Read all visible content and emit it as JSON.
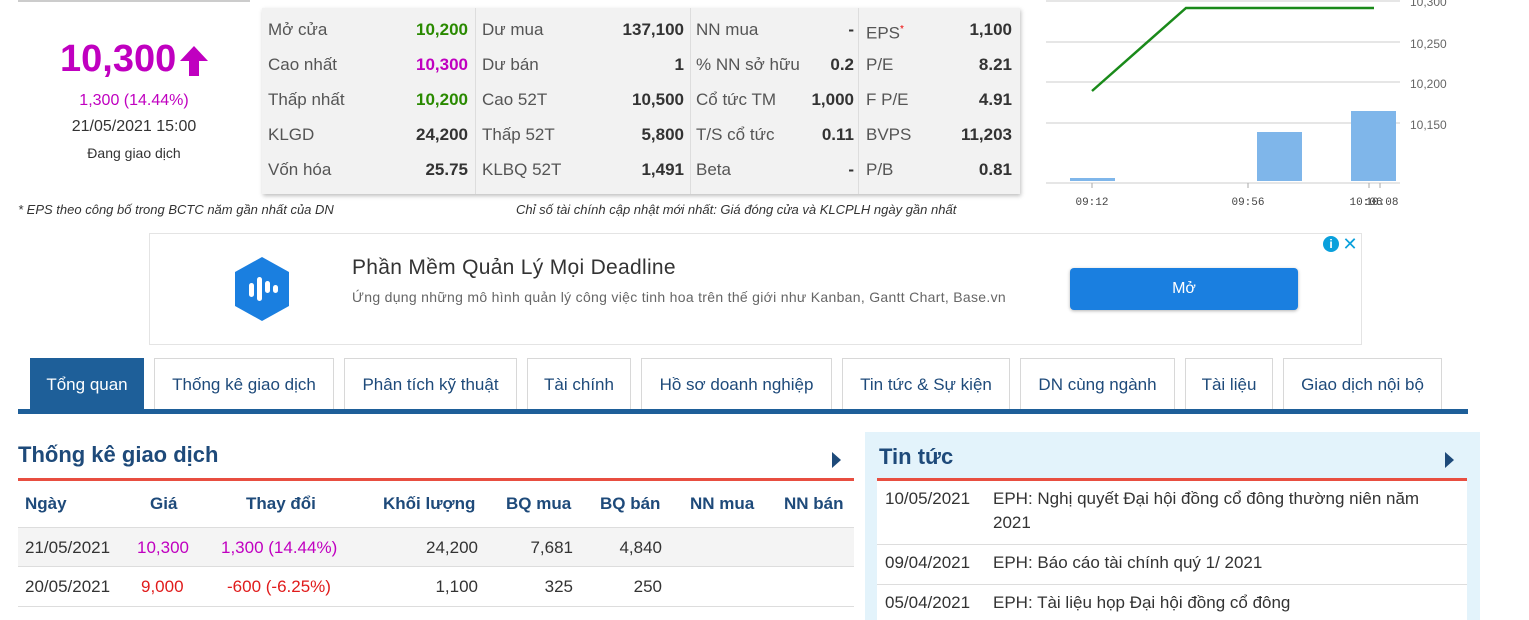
{
  "price": {
    "current": "10,300",
    "change": "1,300 (14.44%)",
    "time": "21/05/2021 15:00",
    "status": "Đang giao dịch"
  },
  "stats": {
    "col1": [
      {
        "label": "Mở cửa",
        "value": "10,200"
      },
      {
        "label": "Cao nhất",
        "value": "10,300"
      },
      {
        "label": "Thấp nhất",
        "value": "10,200"
      },
      {
        "label": "KLGD",
        "value": "24,200"
      },
      {
        "label": "Vốn hóa",
        "value": "25.75"
      }
    ],
    "col2": [
      {
        "label": "Dư mua",
        "value": "137,100"
      },
      {
        "label": "Dư bán",
        "value": "1"
      },
      {
        "label": "Cao 52T",
        "value": "10,500"
      },
      {
        "label": "Thấp 52T",
        "value": "5,800"
      },
      {
        "label": "KLBQ 52T",
        "value": "1,491"
      }
    ],
    "col3": [
      {
        "label": "NN mua",
        "value": "-"
      },
      {
        "label": "% NN sở hữu",
        "value": "0.2"
      },
      {
        "label": "Cổ tức TM",
        "value": "1,000"
      },
      {
        "label": "T/S cổ tức",
        "value": "0.11"
      },
      {
        "label": "Beta",
        "value": "-"
      }
    ],
    "col4": [
      {
        "label": "EPS",
        "star": "*",
        "value": "1,100"
      },
      {
        "label": "P/E",
        "value": "8.21"
      },
      {
        "label": "F P/E",
        "value": "4.91"
      },
      {
        "label": "BVPS",
        "value": "11,203"
      },
      {
        "label": "P/B",
        "value": "0.81"
      }
    ]
  },
  "notes": {
    "left": "* EPS theo công bố trong BCTC năm gần nhất của DN",
    "right": "Chỉ số tài chính cập nhật mới nhất: Giá đóng cửa và KLCPLH ngày gần nhất"
  },
  "mini_chart": {
    "y_ticks": [
      "10,300",
      "10,250",
      "10,200",
      "10,150"
    ],
    "x_ticks": [
      "09:12",
      "09:56",
      "10:06",
      "10:08"
    ],
    "line_color": "#1a8a1a",
    "bar_color": "#7fb6ea"
  },
  "ad": {
    "title": "Phần Mềm Quản Lý Mọi Deadline",
    "description": "Ứng dụng những mô hình quản lý công việc tinh hoa trên thế giới như Kanban, Gantt Chart, Base.vn",
    "button": "Mở",
    "info": "i",
    "close": "✕"
  },
  "tabs": [
    "Tổng quan",
    "Thống kê giao dịch",
    "Phân tích kỹ thuật",
    "Tài chính",
    "Hồ sơ doanh nghiệp",
    "Tin tức & Sự kiện",
    "DN cùng ngành",
    "Tài liệu",
    "Giao dịch nội bộ"
  ],
  "trade": {
    "title": "Thống kê giao dịch",
    "headers": [
      "Ngày",
      "Giá",
      "Thay đổi",
      "Khối lượng",
      "BQ mua",
      "BQ bán",
      "NN mua",
      "NN bán"
    ],
    "rows": [
      {
        "date": "21/05/2021",
        "price": "10,300",
        "change": "1,300 (14.44%)",
        "volume": "24,200",
        "bq_buy": "7,681",
        "bq_sell": "4,840",
        "nn_buy": "",
        "nn_sell": ""
      },
      {
        "date": "20/05/2021",
        "price": "9,000",
        "change": "-600 (-6.25%)",
        "volume": "1,100",
        "bq_buy": "325",
        "bq_sell": "250",
        "nn_buy": "",
        "nn_sell": ""
      }
    ]
  },
  "news": {
    "title": "Tin tức",
    "items": [
      {
        "date": "10/05/2021",
        "text": "EPH: Nghị quyết Đại hội đồng cổ đông thường niên năm 2021"
      },
      {
        "date": "09/04/2021",
        "text": "EPH: Báo cáo tài chính quý 1/ 2021"
      },
      {
        "date": "05/04/2021",
        "text": "EPH: Tài liệu họp Đại hội đồng cổ đông"
      }
    ]
  }
}
